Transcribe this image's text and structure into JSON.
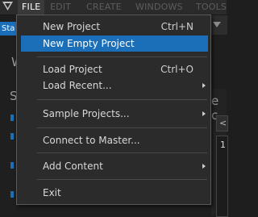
{
  "menubar": {
    "menus": [
      "FILE",
      "EDIT",
      "CREATE",
      "WINDOWS",
      "TOOLS"
    ]
  },
  "background": {
    "tab_label": "Sta",
    "panel_letters": [
      "W",
      "S"
    ],
    "right_label": "e c",
    "right_arrow": "<",
    "right_num": "1"
  },
  "file_menu": {
    "items": [
      {
        "label": "New Project",
        "shortcut": "Ctrl+N"
      },
      {
        "label": "New Empty Project",
        "shortcut": ""
      },
      {
        "label": "Load Project",
        "shortcut": "Ctrl+O"
      },
      {
        "label": "Load Recent...",
        "shortcut": ""
      },
      {
        "label": "Sample Projects...",
        "shortcut": ""
      },
      {
        "label": "Connect to Master...",
        "shortcut": ""
      },
      {
        "label": "Add Content",
        "shortcut": ""
      },
      {
        "label": "Exit",
        "shortcut": ""
      }
    ]
  }
}
